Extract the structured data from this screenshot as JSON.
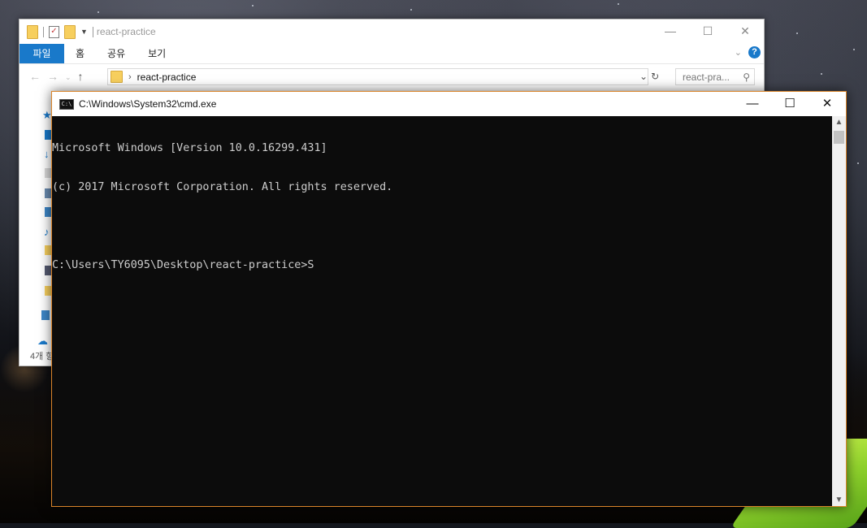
{
  "explorer": {
    "title": "react-practice",
    "ribbon_tabs": [
      "파일",
      "홈",
      "공유",
      "보기"
    ],
    "address": {
      "crumbs": [
        "react-practice"
      ]
    },
    "search_placeholder": "react-pra...",
    "status_text": "4개 항"
  },
  "cmd": {
    "title": "C:\\Windows\\System32\\cmd.exe",
    "lines": [
      "Microsoft Windows [Version 10.0.16299.431]",
      "(c) 2017 Microsoft Corporation. All rights reserved.",
      "",
      "C:\\Users\\TY6095\\Desktop\\react-practice>S"
    ]
  },
  "colors": {
    "cmd_border": "#d9842a",
    "ribbon_file_tab": "#1979ca",
    "console_bg": "#0c0c0c",
    "console_text": "#cccccc"
  }
}
